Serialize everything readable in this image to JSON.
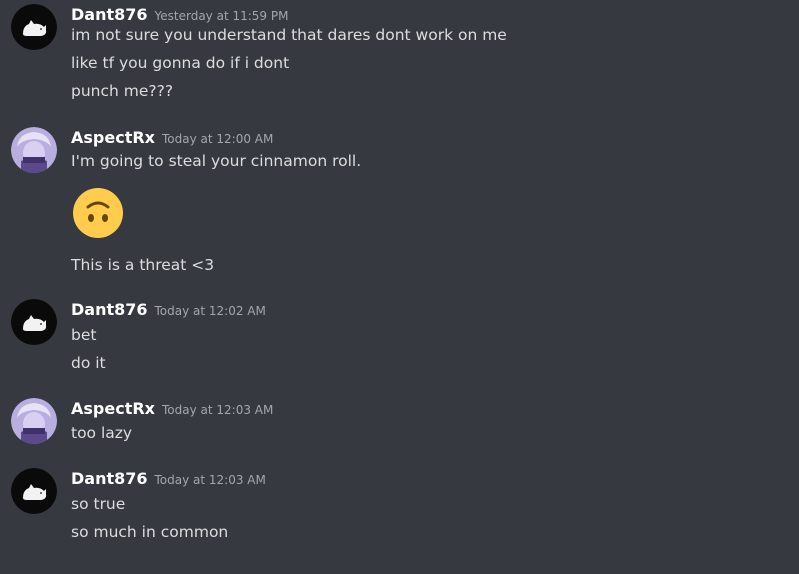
{
  "messages": [
    {
      "author": "Dant876",
      "avatar_icon": "dant-cat-avatar-icon",
      "timestamp": "Yesterday at 11:59 PM",
      "lines": [
        "im not sure you understand that dares dont work on me",
        "like tf you gonna do if i dont",
        "punch me???"
      ]
    },
    {
      "author": "AspectRx",
      "avatar_icon": "aspect-anime-avatar-icon",
      "timestamp": "Today at 12:00 AM",
      "lines": [
        "I'm going to steal your cinnamon roll.",
        "This is a threat <3"
      ],
      "emoji": "upside-down-face-icon"
    },
    {
      "author": "Dant876",
      "avatar_icon": "dant-cat-avatar-icon",
      "timestamp": "Today at 12:02 AM",
      "lines": [
        "bet",
        "do it"
      ]
    },
    {
      "author": "AspectRx",
      "avatar_icon": "aspect-anime-avatar-icon",
      "timestamp": "Today at 12:03 AM",
      "lines": [
        "too lazy"
      ]
    },
    {
      "author": "Dant876",
      "avatar_icon": "dant-cat-avatar-icon",
      "timestamp": "Today at 12:03 AM",
      "lines": [
        "so true",
        "so much in common"
      ]
    }
  ],
  "colors": {
    "background": "#36393f",
    "username": "#ffffff",
    "timestamp": "#a3a6aa",
    "text": "#dcddde",
    "emoji_yellow": "#ffcc4d"
  }
}
